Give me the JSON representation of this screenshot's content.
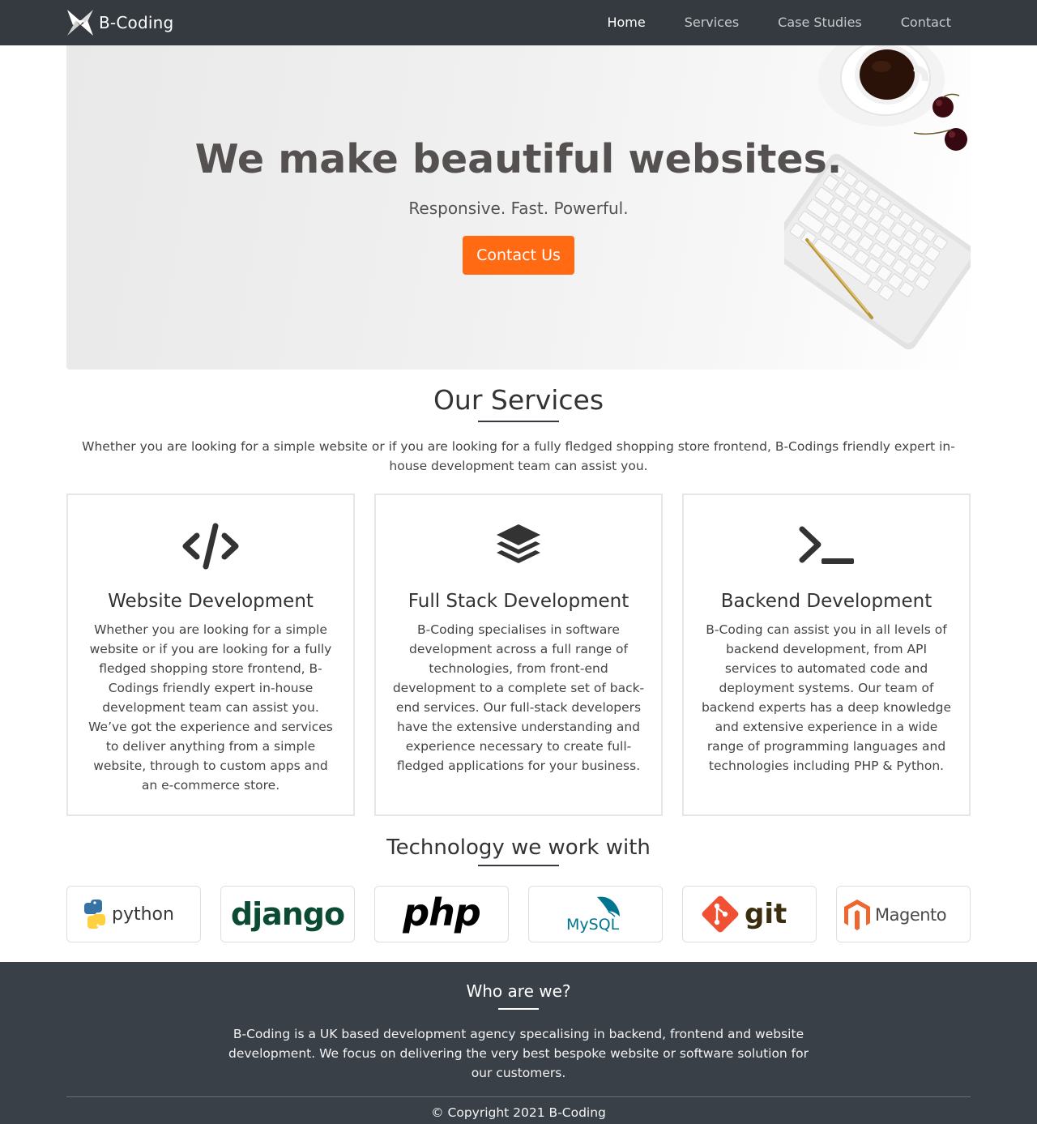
{
  "nav": {
    "brand": "B-Coding",
    "links": [
      "Home",
      "Services",
      "Case Studies",
      "Contact"
    ],
    "active": "Home"
  },
  "hero": {
    "title": "We make beautiful websites.",
    "subtitle": "Responsive. Fast. Powerful.",
    "button_label": "Contact Us"
  },
  "services": {
    "title": "Our Services",
    "intro": "Whether you are looking for a simple website or if you are looking for a fully fledged shopping store frontend, B-Codings friendly expert in-house development team can assist you.",
    "cards": [
      {
        "icon": "code-icon",
        "title": "Website Development",
        "text": "Whether you are looking for a simple website or if you are looking for a fully fledged shopping store frontend, B-Codings friendly expert in-house development team can assist you. We’ve got the experience and services to deliver anything from a simple website, through to custom apps and an e-commerce store."
      },
      {
        "icon": "layers-icon",
        "title": "Full Stack Development",
        "text": "B-Coding specialises in software development across a full range of technologies, from front-end development to a complete set of back-end services. Our full-stack developers have the extensive understanding and experience necessary to create full-fledged applications for your business."
      },
      {
        "icon": "terminal-icon",
        "title": "Backend Development",
        "text": "B-Coding can assist you in all levels of backend development, from API services to automated code and deployment systems. Our team of backend experts has a deep knowledge and extensive experience in a wide range of programming languages and technologies including PHP & Python."
      }
    ]
  },
  "technology": {
    "title": "Technology we work with",
    "logos": [
      {
        "name": "python",
        "text": "python",
        "color": "#3a3a3a"
      },
      {
        "name": "django",
        "text": "django",
        "color": "#0c4b33"
      },
      {
        "name": "php",
        "text": "php",
        "color": "#000000"
      },
      {
        "name": "mysql",
        "text": "MySQL",
        "color": "#00758f"
      },
      {
        "name": "git",
        "text": "git",
        "color": "#f05133"
      },
      {
        "name": "magento",
        "text": "Magento",
        "color": "#ee672f"
      }
    ]
  },
  "footer": {
    "title": "Who are we?",
    "text": "B-Coding is a UK based development agency specalising in backend, frontend and website development. We focus on delivering the very best bespoke website or software solution for our customers.",
    "copyright": "© Copyright 2021 B-Coding"
  },
  "colors": {
    "navbar": "#343a40",
    "footer": "#3a4048",
    "accent": "#ff6a13",
    "icon": "#333333"
  }
}
